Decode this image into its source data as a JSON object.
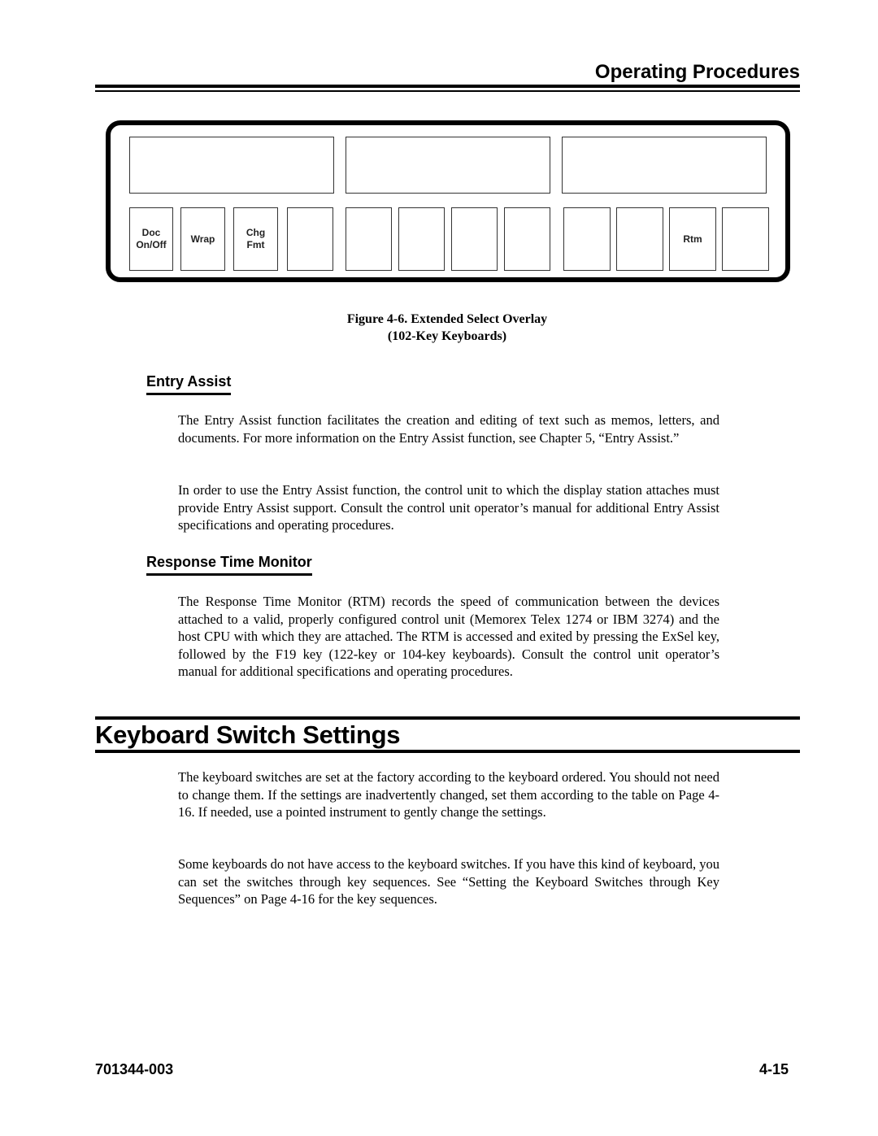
{
  "header": {
    "running_title": "Operating Procedures"
  },
  "figure": {
    "keys": [
      {
        "line1": "Doc",
        "line2": "On/Off"
      },
      {
        "line1": "Wrap",
        "line2": ""
      },
      {
        "line1": "Chg",
        "line2": "Fmt"
      },
      {
        "line1": "",
        "line2": ""
      },
      {
        "line1": "",
        "line2": ""
      },
      {
        "line1": "",
        "line2": ""
      },
      {
        "line1": "",
        "line2": ""
      },
      {
        "line1": "",
        "line2": ""
      },
      {
        "line1": "",
        "line2": ""
      },
      {
        "line1": "",
        "line2": ""
      },
      {
        "line1": "Rtm",
        "line2": ""
      },
      {
        "line1": "",
        "line2": ""
      }
    ],
    "caption_line1": "Figure 4-6.  Extended Select Overlay",
    "caption_line2": "(102-Key Keyboards)"
  },
  "entry_assist": {
    "heading": "Entry Assist",
    "paragraphs": [
      "The Entry Assist function facilitates the creation and editing of text such as memos, letters, and documents. For more information on the Entry Assist function, see Chapter 5, “Entry Assist.”",
      "In order to use the Entry Assist function, the control unit to which the display station attaches must provide Entry Assist support. Consult the control unit operator’s manual for additional Entry Assist specifications and operating procedures."
    ]
  },
  "response_time_monitor": {
    "heading": "Response Time Monitor",
    "paragraphs": [
      "The Response Time Monitor (RTM) records the speed of communication between the devices attached to a valid, properly configured control unit (Memorex Telex 1274 or IBM 3274) and the host CPU with which they are attached. The RTM is accessed and exited by pressing the ExSel key, followed by the F19 key (122-key or 104-key keyboards). Consult the control unit operator’s manual for additional specifications and operating procedures."
    ]
  },
  "keyboard_switch_settings": {
    "heading": "Keyboard Switch Settings",
    "paragraphs": [
      "The keyboard switches are set at the factory according to the keyboard ordered. You should not need to change them. If the settings are inadvertently changed, set them according to the table on Page 4-16. If needed, use a pointed instrument to gently change the settings.",
      "Some keyboards do not have access to the keyboard switches. If you have this kind of keyboard, you can set the switches through key sequences. See “Setting the Keyboard Switches through Key Sequences” on Page 4-16 for the key sequences."
    ]
  },
  "footer": {
    "doc_number": "701344-003",
    "page_number": "4-15"
  }
}
